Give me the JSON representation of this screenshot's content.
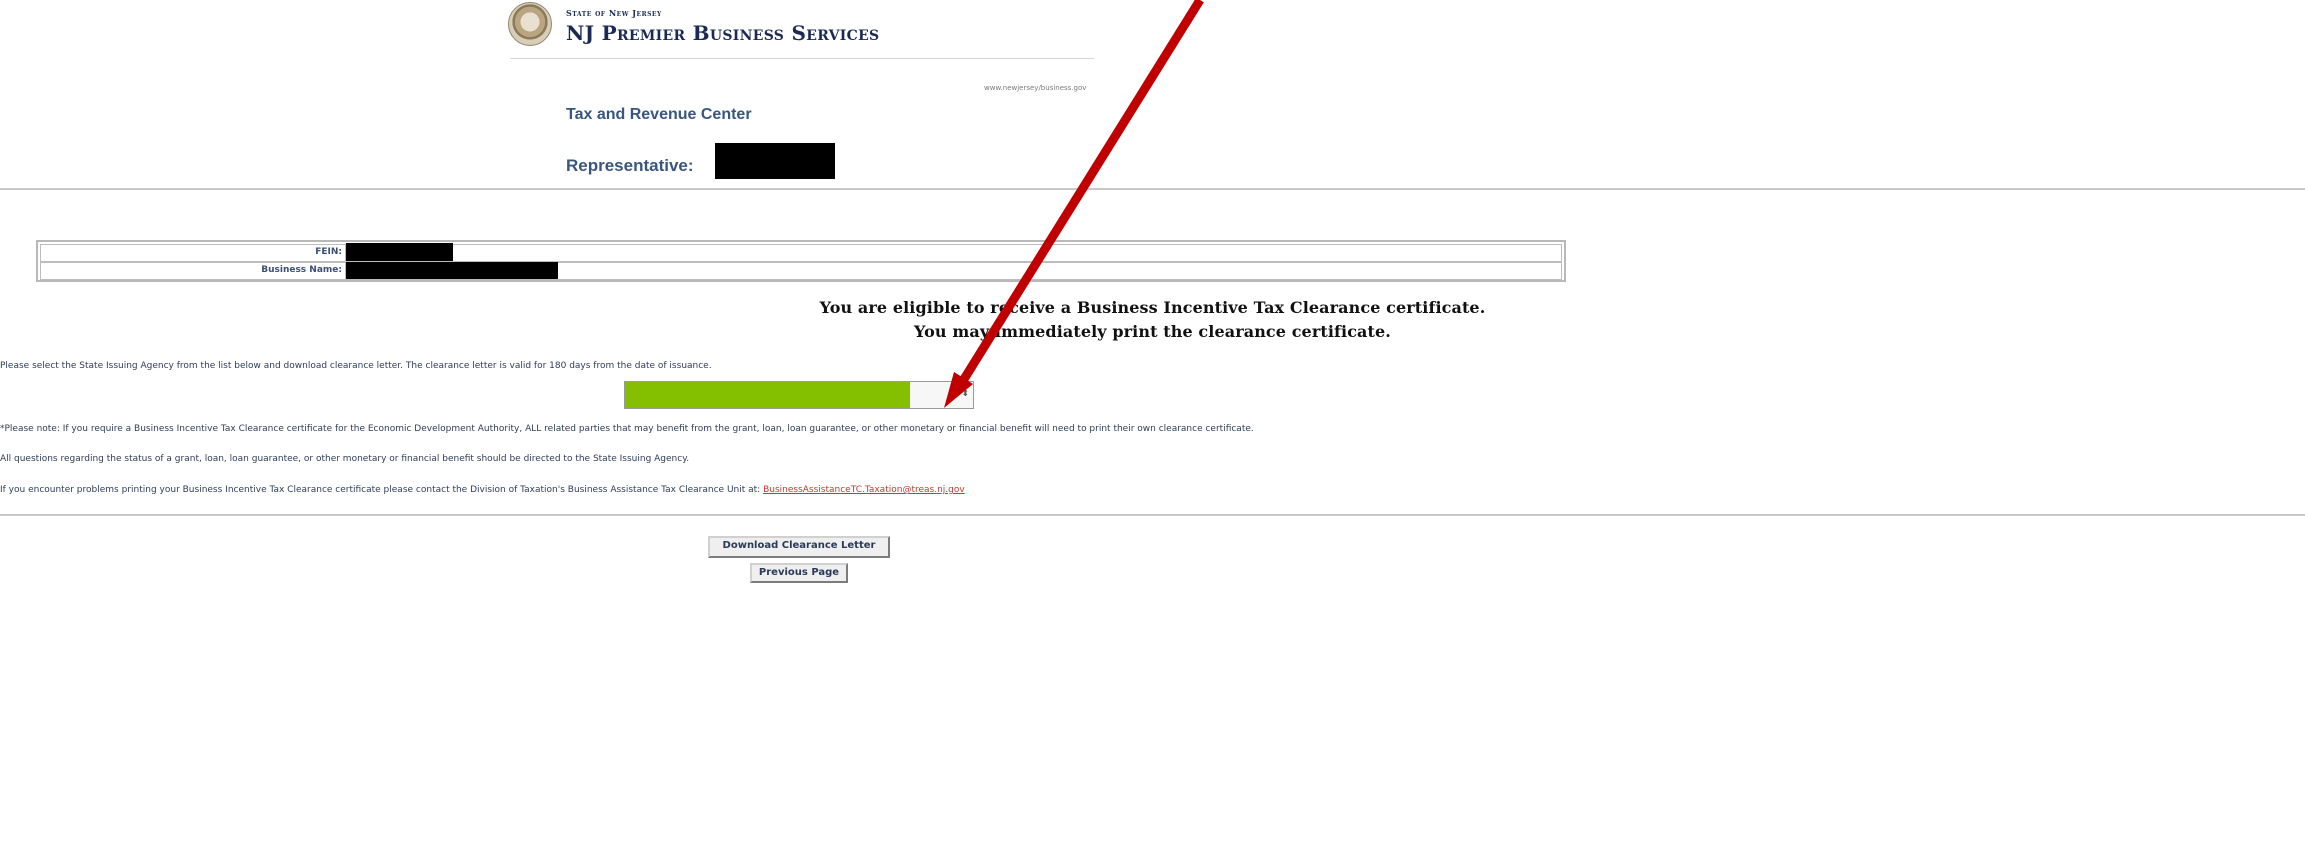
{
  "header": {
    "state_label": "State of New Jersey",
    "brand_title": "NJ Premier Business Services",
    "site_url": "www.newjersey/business.gov",
    "center_title": "Tax and Revenue Center",
    "representative_label": "Representative:"
  },
  "info_table": {
    "fein_label": "FEIN:",
    "business_name_label": "Business Name:"
  },
  "eligibility": {
    "line1": "You are eligible to receive a Business Incentive Tax Clearance certificate.",
    "line2": "You may immediately print the clearance certificate."
  },
  "instructions": {
    "select_prompt": "Please select the State Issuing Agency from the list below and download clearance letter. The clearance letter is valid for 180 days from the date of issuance."
  },
  "agency_select": {
    "arrow_glyph": "⬍",
    "highlight_color": "#84c000"
  },
  "notes": {
    "note1": "*Please note: If you require a Business Incentive Tax Clearance certificate for the Economic Development Authority, ALL related parties that may benefit from the grant, loan, loan guarantee, or other monetary or financial benefit will need to print their own clearance certificate.",
    "note2": "All questions regarding the status of a grant, loan, loan guarantee, or other monetary or financial benefit should be directed to the State Issuing Agency.",
    "note3_prefix": "If you encounter problems printing your Business Incentive Tax Clearance certificate please contact the Division of Taxation's Business Assistance Tax Clearance Unit at:",
    "contact_email": "BusinessAssistanceTC.Taxation@treas.nj.gov"
  },
  "buttons": {
    "download_label": "Download Clearance Letter",
    "previous_label": "Previous Page"
  },
  "annotation": {
    "arrow_color": "#c00000",
    "redaction_color": "#000000"
  },
  "icons": {
    "seal": "state-seal-icon",
    "select_arrow": "updown-arrow-icon"
  }
}
